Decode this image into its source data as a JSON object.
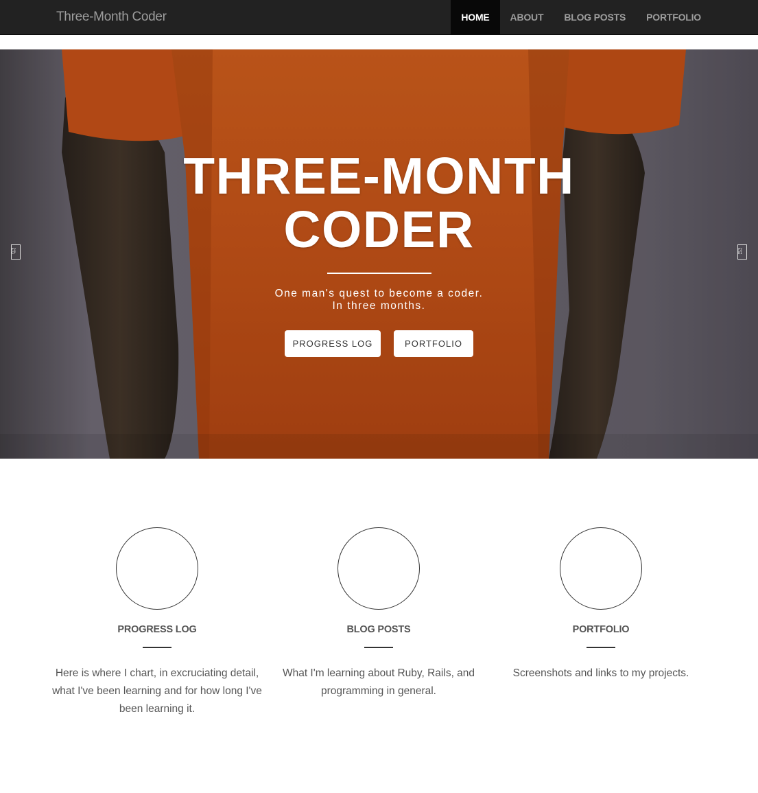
{
  "navbar": {
    "brand": "Three-Month Coder",
    "items": [
      {
        "label": "HOME",
        "active": true
      },
      {
        "label": "ABOUT",
        "active": false
      },
      {
        "label": "BLOG POSTS",
        "active": false
      },
      {
        "label": "PORTFOLIO",
        "active": false
      }
    ]
  },
  "hero": {
    "title": "THREE-MONTH CODER",
    "subtitle_line1": "One man's quest to become a coder.",
    "subtitle_line2": "In three months.",
    "buttons": {
      "progress_label": "PROGRESS LOG",
      "portfolio_label": "PORTFOLIO"
    },
    "controls": {
      "prev_glyph": "F2 CF",
      "next_glyph": "F2 D1"
    }
  },
  "features": [
    {
      "title": "PROGRESS LOG",
      "text": "Here is where I chart, in excruciating detail, what I've been learning and for how long I've been learning it."
    },
    {
      "title": "BLOG POSTS",
      "text": "What I'm learning about Ruby, Rails, and programming in general."
    },
    {
      "title": "PORTFOLIO",
      "text": "Screenshots and links to my projects."
    }
  ],
  "colors": {
    "navbar_bg": "#222222",
    "nav_active_bg": "#080808",
    "hero_shirt": "#d4541c",
    "text": "#555555"
  }
}
